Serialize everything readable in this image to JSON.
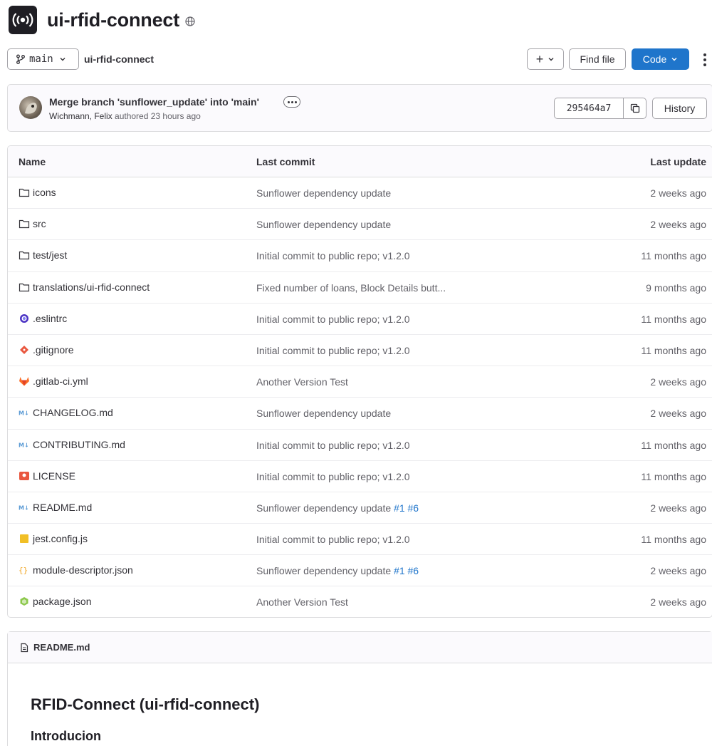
{
  "repo": {
    "title": "ui-rfid-connect"
  },
  "toolbar": {
    "branch": "main",
    "breadcrumb_root": "ui-rfid-connect",
    "plus_label": "+",
    "find_file_label": "Find file",
    "code_label": "Code"
  },
  "commit": {
    "title": "Merge branch 'sunflower_update' into 'main'",
    "author": "Wichmann, Felix",
    "authored_text": "authored 23 hours ago",
    "sha": "295464a7",
    "history_label": "History"
  },
  "table": {
    "headers": {
      "name": "Name",
      "last_commit": "Last commit",
      "last_update": "Last update"
    },
    "rows": [
      {
        "icon": "folder-icon",
        "name": "icons",
        "commit": "Sunflower dependency update",
        "links": [],
        "date": "2 weeks ago"
      },
      {
        "icon": "folder-icon",
        "name": "src",
        "commit": "Sunflower dependency update",
        "links": [],
        "date": "2 weeks ago"
      },
      {
        "icon": "folder-icon",
        "name": "test/jest",
        "commit": "Initial commit to public repo; v1.2.0",
        "links": [],
        "date": "11 months ago"
      },
      {
        "icon": "folder-icon",
        "name": "translations/ui-rfid-connect",
        "commit": "Fixed number of loans, Block Details butt...",
        "links": [],
        "date": "9 months ago"
      },
      {
        "icon": "eslint-icon",
        "name": ".eslintrc",
        "commit": "Initial commit to public repo; v1.2.0",
        "links": [],
        "date": "11 months ago"
      },
      {
        "icon": "git-icon",
        "name": ".gitignore",
        "commit": "Initial commit to public repo; v1.2.0",
        "links": [],
        "date": "11 months ago"
      },
      {
        "icon": "gitlab-icon",
        "name": ".gitlab-ci.yml",
        "commit": "Another Version Test",
        "links": [],
        "date": "2 weeks ago"
      },
      {
        "icon": "markdown-icon",
        "name": "CHANGELOG.md",
        "commit": "Sunflower dependency update",
        "links": [],
        "date": "2 weeks ago"
      },
      {
        "icon": "markdown-icon",
        "name": "CONTRIBUTING.md",
        "commit": "Initial commit to public repo; v1.2.0",
        "links": [],
        "date": "11 months ago"
      },
      {
        "icon": "license-icon",
        "name": "LICENSE",
        "commit": "Initial commit to public repo; v1.2.0",
        "links": [],
        "date": "11 months ago"
      },
      {
        "icon": "markdown-icon",
        "name": "README.md",
        "commit": "Sunflower dependency update",
        "links": [
          "#1",
          "#6"
        ],
        "date": "2 weeks ago"
      },
      {
        "icon": "javascript-icon",
        "name": "jest.config.js",
        "commit": "Initial commit to public repo; v1.2.0",
        "links": [],
        "date": "11 months ago"
      },
      {
        "icon": "json-icon",
        "name": "module-descriptor.json",
        "commit": "Sunflower dependency update",
        "links": [
          "#1",
          "#6"
        ],
        "date": "2 weeks ago"
      },
      {
        "icon": "npm-package-icon",
        "name": "package.json",
        "commit": "Another Version Test",
        "links": [],
        "date": "2 weeks ago"
      }
    ]
  },
  "readme": {
    "filename": "README.md",
    "heading": "RFID-Connect (ui-rfid-connect)",
    "subheading": "Introducion"
  },
  "colors": {
    "primary_blue": "#1f75cb",
    "text": "#333238",
    "muted": "#626168",
    "border": "#dcdcde"
  }
}
